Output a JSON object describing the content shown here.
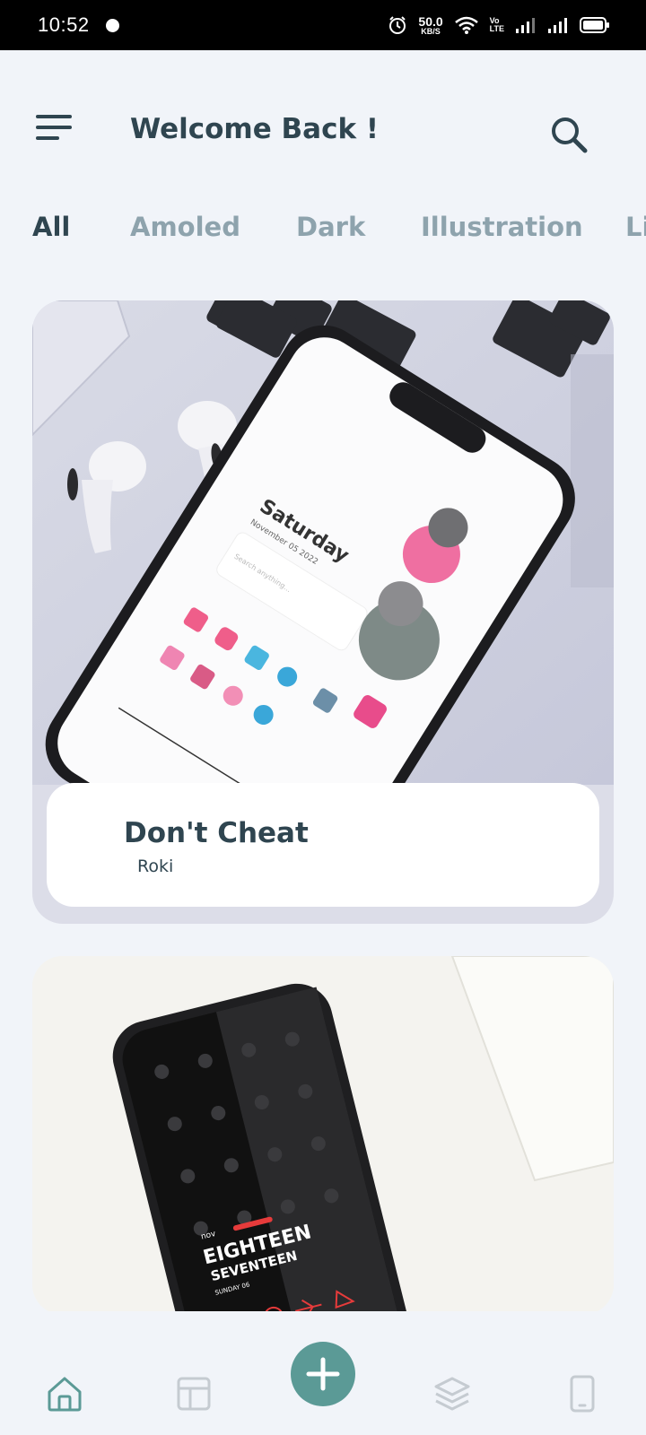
{
  "status_bar": {
    "time": "10:52",
    "net_speed_value": "50.0",
    "net_speed_unit": "KB/S",
    "volte_top": "Vo",
    "volte_bottom": "LTE",
    "icons": [
      "alarm-icon",
      "wifi-icon",
      "signal-icon",
      "signal-icon",
      "battery-icon"
    ]
  },
  "header": {
    "title": "Welcome Back !",
    "menu_icon": "menu-icon",
    "search_icon": "search-icon"
  },
  "categories": {
    "items": [
      "All",
      "Amoled",
      "Dark",
      "Illustration",
      "Li"
    ],
    "active": "All"
  },
  "cards": [
    {
      "title": "Don't Cheat",
      "author": "Roki"
    },
    {
      "phone_text_line1": "EIGHTEEN",
      "phone_text_line2": "SEVENTEEN",
      "phone_text_small": "SUNDAY 06",
      "phone_text_tag": "nov"
    }
  ],
  "card1_phone": {
    "day": "Saturday",
    "date": "November 05 2022",
    "search": "Search anything..."
  },
  "bottom_nav": {
    "items": [
      "home-icon",
      "layout-icon",
      "add-icon",
      "layers-icon",
      "phone-icon"
    ],
    "active": "home-icon"
  },
  "colors": {
    "accent": "#5b9a96",
    "text_dark": "#2f4550",
    "text_muted": "#8ea3ad",
    "background": "#f1f4f9"
  }
}
